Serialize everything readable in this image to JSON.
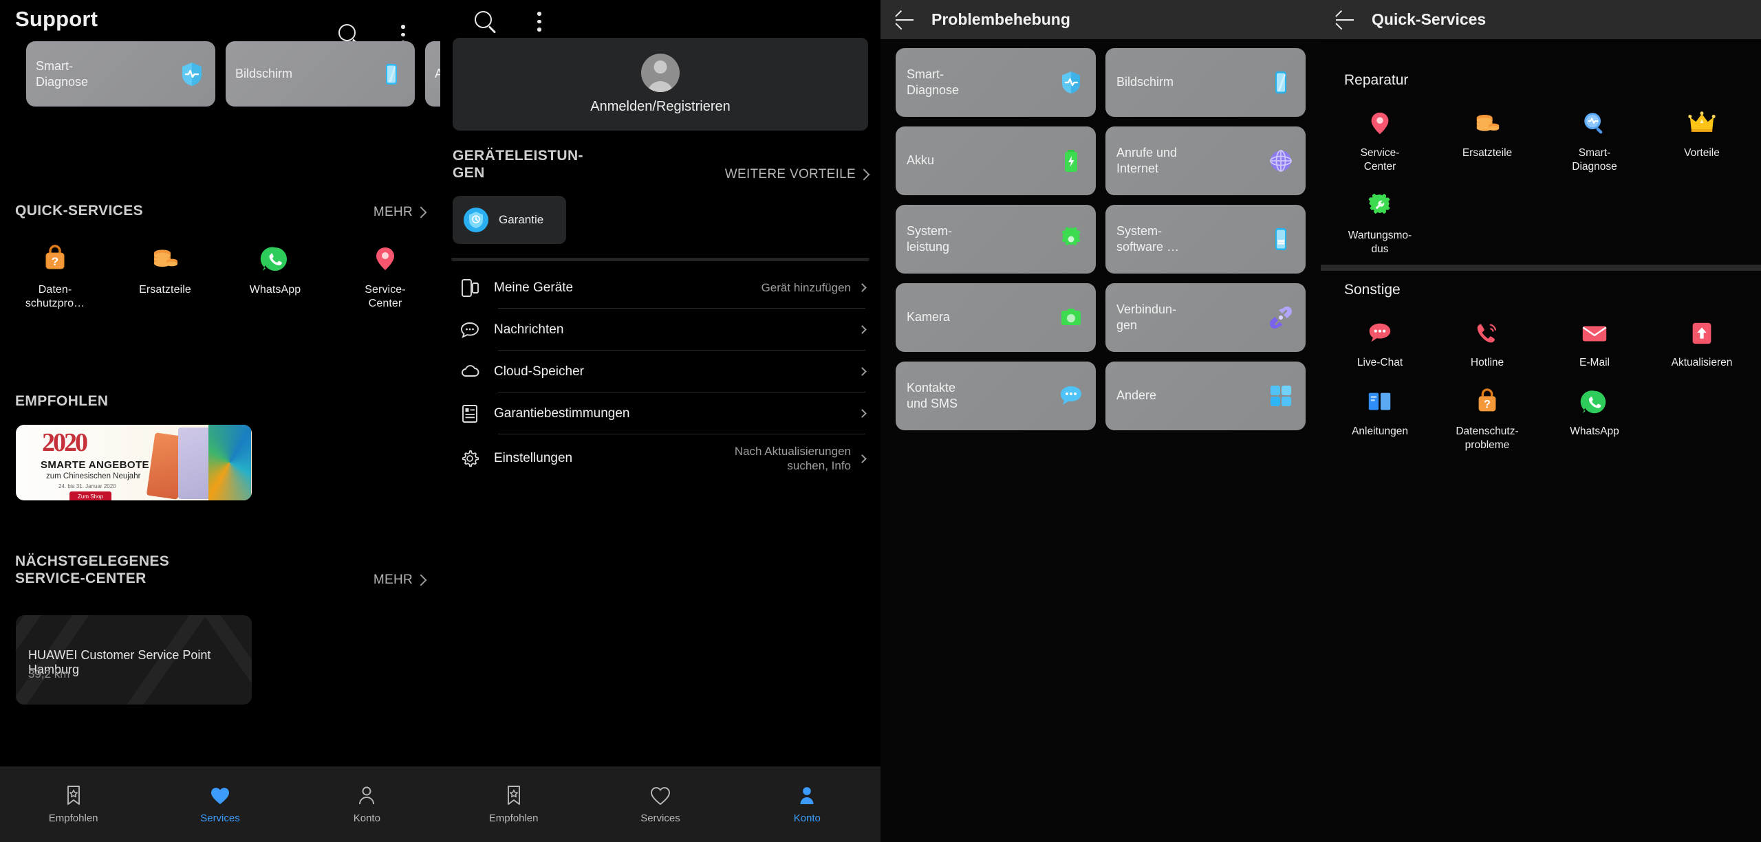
{
  "panel1": {
    "title": "Support",
    "icons": {
      "search": "search-icon",
      "menu": "more-vertical-icon"
    },
    "top_cards": [
      {
        "label": "Smart-\nDiagnose",
        "icon": "shield-pulse-icon"
      },
      {
        "label": "Bildschirm",
        "icon": "phone-screen-icon"
      },
      {
        "label": "A",
        "icon": "partial-icon"
      }
    ],
    "quick_services": {
      "title": "QUICK-SERVICES",
      "more": "MEHR",
      "items": [
        {
          "label": "Daten-\nschutzpro…",
          "icon": "privacy-bag-icon"
        },
        {
          "label": "Ersatzteile",
          "icon": "coins-icon"
        },
        {
          "label": "WhatsApp",
          "icon": "whatsapp-icon"
        },
        {
          "label": "Service-\nCenter",
          "icon": "location-pin-icon"
        }
      ]
    },
    "recommended": {
      "title": "EMPFOHLEN",
      "banner": {
        "year": "2020",
        "headline": "SMARTE ANGEBOTE",
        "subline": "zum Chinesischen Neujahr",
        "dates": "24. bis 31. Januar 2020",
        "cta": "Zum Shop"
      }
    },
    "nearest_service": {
      "title": "NÄCHSTGELEGENES\nSERVICE-CENTER",
      "more": "MEHR",
      "name": "HUAWEI Customer Service Point Hamburg",
      "distance": "39,2 km"
    },
    "bottom_nav": [
      {
        "label": "Empfohlen",
        "icon": "bookmark-star-icon",
        "active": false
      },
      {
        "label": "Services",
        "icon": "heart-filled-icon",
        "active": true
      },
      {
        "label": "Konto",
        "icon": "person-outline-icon",
        "active": false
      }
    ]
  },
  "panel2": {
    "icons": {
      "search": "search-icon",
      "menu": "more-vertical-icon"
    },
    "account": {
      "label": "Anmelden/Registrieren",
      "avatar": "avatar-placeholder-icon"
    },
    "benefits": {
      "title": "GERÄTELEISTUN-\nGEN",
      "more": "WEITERE VORTEILE",
      "card": {
        "label": "Garantie",
        "icon": "warranty-shield-icon"
      }
    },
    "menu": [
      {
        "label": "Meine Geräte",
        "value": "Gerät hinzufügen",
        "icon": "devices-icon"
      },
      {
        "label": "Nachrichten",
        "value": "",
        "icon": "chat-bubble-icon"
      },
      {
        "label": "Cloud-Speicher",
        "value": "",
        "icon": "cloud-icon"
      },
      {
        "label": "Garantiebestimmungen",
        "value": "",
        "icon": "document-list-icon"
      },
      {
        "label": "Einstellungen",
        "value": "Nach Aktualisierungen\nsuchen, Info",
        "icon": "gear-icon"
      }
    ],
    "bottom_nav": [
      {
        "label": "Empfohlen",
        "icon": "bookmark-star-icon",
        "active": false
      },
      {
        "label": "Services",
        "icon": "heart-outline-icon",
        "active": false
      },
      {
        "label": "Konto",
        "icon": "person-filled-icon",
        "active": true
      }
    ]
  },
  "panel3": {
    "title": "Problembehebung",
    "back": "back-arrow-icon",
    "tiles": [
      {
        "label": "Smart-\nDiagnose",
        "icon": "shield-pulse-icon"
      },
      {
        "label": "Bildschirm",
        "icon": "phone-screen-icon"
      },
      {
        "label": "Akku",
        "icon": "battery-icon"
      },
      {
        "label": "Anrufe und\nInternet",
        "icon": "globe-icon"
      },
      {
        "label": "System-\nleistung",
        "icon": "gear-green-icon"
      },
      {
        "label": "System-\nsoftware …",
        "icon": "phone-apps-icon"
      },
      {
        "label": "Kamera",
        "icon": "camera-icon"
      },
      {
        "label": "Verbindun-\ngen",
        "icon": "link-icon"
      },
      {
        "label": "Kontakte\nund SMS",
        "icon": "sms-bubble-icon"
      },
      {
        "label": "Andere",
        "icon": "grid-apps-icon"
      }
    ]
  },
  "panel4": {
    "title": "Quick-Services",
    "back": "back-arrow-icon",
    "sections": [
      {
        "title": "Reparatur",
        "items": [
          {
            "label": "Service-\nCenter",
            "icon": "location-pin-icon"
          },
          {
            "label": "Ersatzteile",
            "icon": "coins-icon"
          },
          {
            "label": "Smart-\nDiagnose",
            "icon": "magnifier-pulse-icon"
          },
          {
            "label": "Vorteile",
            "icon": "crown-icon"
          },
          {
            "label": "Wartungsmo-\ndus",
            "icon": "gear-wrench-icon"
          }
        ]
      },
      {
        "title": "Sonstige",
        "items": [
          {
            "label": "Live-Chat",
            "icon": "chat-bubble-red-icon"
          },
          {
            "label": "Hotline",
            "icon": "phone-call-icon"
          },
          {
            "label": "E-Mail",
            "icon": "mail-icon"
          },
          {
            "label": "Aktualisieren",
            "icon": "update-arrow-icon"
          },
          {
            "label": "Anleitungen",
            "icon": "manual-book-icon"
          },
          {
            "label": "Datenschutz-\nprobleme",
            "icon": "privacy-bag-icon"
          },
          {
            "label": "WhatsApp",
            "icon": "whatsapp-icon"
          }
        ]
      }
    ]
  },
  "colors": {
    "accent": "#3d9bfb",
    "orange": "#f0922e",
    "green": "#3ecd46",
    "red": "#f4566a",
    "pink": "#f7566e",
    "purple": "#8b7bf0",
    "cyan": "#4fc3f7",
    "yellow": "#f9c80e",
    "whatsapp": "#25d366"
  }
}
